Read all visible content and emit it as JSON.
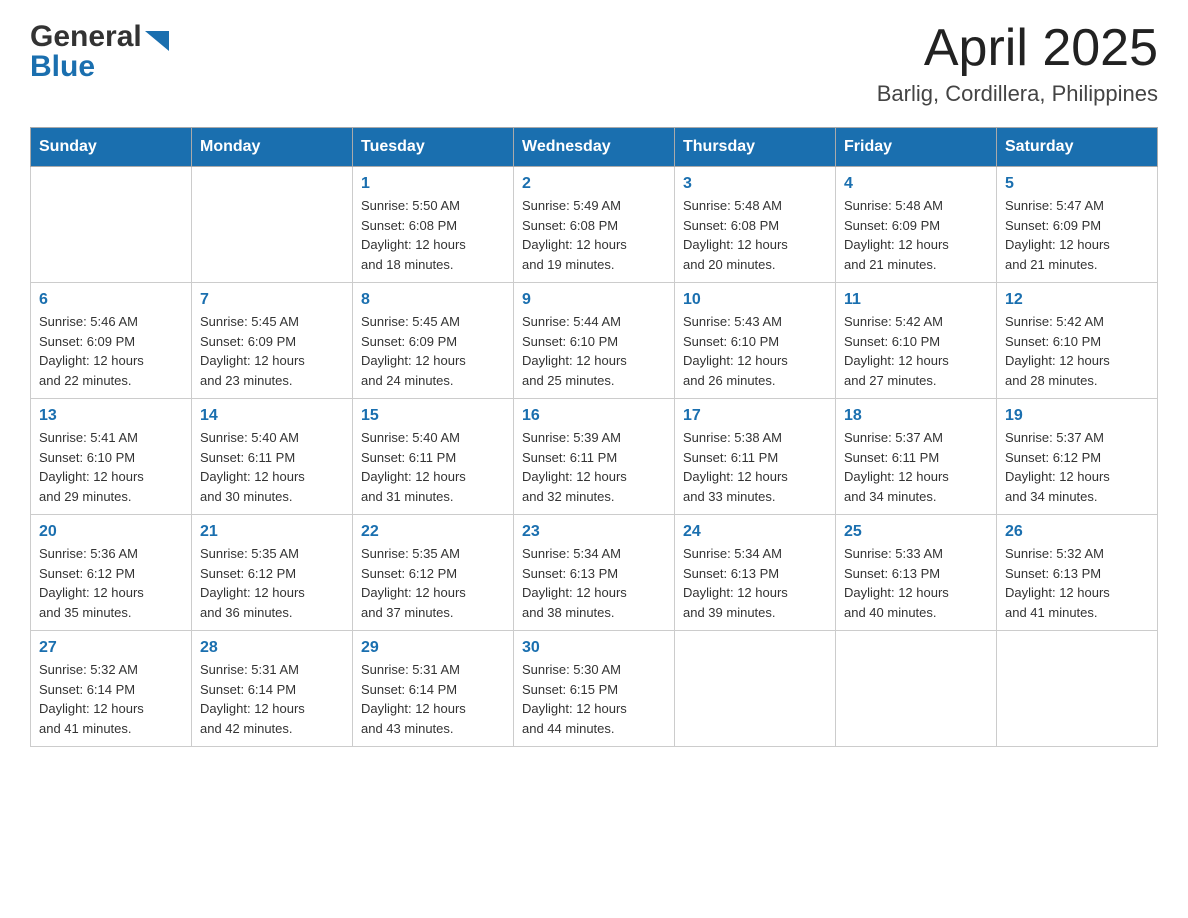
{
  "header": {
    "logo_general": "General",
    "logo_blue": "Blue",
    "month_title": "April 2025",
    "location": "Barlig, Cordillera, Philippines"
  },
  "days_of_week": [
    "Sunday",
    "Monday",
    "Tuesday",
    "Wednesday",
    "Thursday",
    "Friday",
    "Saturday"
  ],
  "weeks": [
    [
      {
        "day": "",
        "info": ""
      },
      {
        "day": "",
        "info": ""
      },
      {
        "day": "1",
        "info": "Sunrise: 5:50 AM\nSunset: 6:08 PM\nDaylight: 12 hours\nand 18 minutes."
      },
      {
        "day": "2",
        "info": "Sunrise: 5:49 AM\nSunset: 6:08 PM\nDaylight: 12 hours\nand 19 minutes."
      },
      {
        "day": "3",
        "info": "Sunrise: 5:48 AM\nSunset: 6:08 PM\nDaylight: 12 hours\nand 20 minutes."
      },
      {
        "day": "4",
        "info": "Sunrise: 5:48 AM\nSunset: 6:09 PM\nDaylight: 12 hours\nand 21 minutes."
      },
      {
        "day": "5",
        "info": "Sunrise: 5:47 AM\nSunset: 6:09 PM\nDaylight: 12 hours\nand 21 minutes."
      }
    ],
    [
      {
        "day": "6",
        "info": "Sunrise: 5:46 AM\nSunset: 6:09 PM\nDaylight: 12 hours\nand 22 minutes."
      },
      {
        "day": "7",
        "info": "Sunrise: 5:45 AM\nSunset: 6:09 PM\nDaylight: 12 hours\nand 23 minutes."
      },
      {
        "day": "8",
        "info": "Sunrise: 5:45 AM\nSunset: 6:09 PM\nDaylight: 12 hours\nand 24 minutes."
      },
      {
        "day": "9",
        "info": "Sunrise: 5:44 AM\nSunset: 6:10 PM\nDaylight: 12 hours\nand 25 minutes."
      },
      {
        "day": "10",
        "info": "Sunrise: 5:43 AM\nSunset: 6:10 PM\nDaylight: 12 hours\nand 26 minutes."
      },
      {
        "day": "11",
        "info": "Sunrise: 5:42 AM\nSunset: 6:10 PM\nDaylight: 12 hours\nand 27 minutes."
      },
      {
        "day": "12",
        "info": "Sunrise: 5:42 AM\nSunset: 6:10 PM\nDaylight: 12 hours\nand 28 minutes."
      }
    ],
    [
      {
        "day": "13",
        "info": "Sunrise: 5:41 AM\nSunset: 6:10 PM\nDaylight: 12 hours\nand 29 minutes."
      },
      {
        "day": "14",
        "info": "Sunrise: 5:40 AM\nSunset: 6:11 PM\nDaylight: 12 hours\nand 30 minutes."
      },
      {
        "day": "15",
        "info": "Sunrise: 5:40 AM\nSunset: 6:11 PM\nDaylight: 12 hours\nand 31 minutes."
      },
      {
        "day": "16",
        "info": "Sunrise: 5:39 AM\nSunset: 6:11 PM\nDaylight: 12 hours\nand 32 minutes."
      },
      {
        "day": "17",
        "info": "Sunrise: 5:38 AM\nSunset: 6:11 PM\nDaylight: 12 hours\nand 33 minutes."
      },
      {
        "day": "18",
        "info": "Sunrise: 5:37 AM\nSunset: 6:11 PM\nDaylight: 12 hours\nand 34 minutes."
      },
      {
        "day": "19",
        "info": "Sunrise: 5:37 AM\nSunset: 6:12 PM\nDaylight: 12 hours\nand 34 minutes."
      }
    ],
    [
      {
        "day": "20",
        "info": "Sunrise: 5:36 AM\nSunset: 6:12 PM\nDaylight: 12 hours\nand 35 minutes."
      },
      {
        "day": "21",
        "info": "Sunrise: 5:35 AM\nSunset: 6:12 PM\nDaylight: 12 hours\nand 36 minutes."
      },
      {
        "day": "22",
        "info": "Sunrise: 5:35 AM\nSunset: 6:12 PM\nDaylight: 12 hours\nand 37 minutes."
      },
      {
        "day": "23",
        "info": "Sunrise: 5:34 AM\nSunset: 6:13 PM\nDaylight: 12 hours\nand 38 minutes."
      },
      {
        "day": "24",
        "info": "Sunrise: 5:34 AM\nSunset: 6:13 PM\nDaylight: 12 hours\nand 39 minutes."
      },
      {
        "day": "25",
        "info": "Sunrise: 5:33 AM\nSunset: 6:13 PM\nDaylight: 12 hours\nand 40 minutes."
      },
      {
        "day": "26",
        "info": "Sunrise: 5:32 AM\nSunset: 6:13 PM\nDaylight: 12 hours\nand 41 minutes."
      }
    ],
    [
      {
        "day": "27",
        "info": "Sunrise: 5:32 AM\nSunset: 6:14 PM\nDaylight: 12 hours\nand 41 minutes."
      },
      {
        "day": "28",
        "info": "Sunrise: 5:31 AM\nSunset: 6:14 PM\nDaylight: 12 hours\nand 42 minutes."
      },
      {
        "day": "29",
        "info": "Sunrise: 5:31 AM\nSunset: 6:14 PM\nDaylight: 12 hours\nand 43 minutes."
      },
      {
        "day": "30",
        "info": "Sunrise: 5:30 AM\nSunset: 6:15 PM\nDaylight: 12 hours\nand 44 minutes."
      },
      {
        "day": "",
        "info": ""
      },
      {
        "day": "",
        "info": ""
      },
      {
        "day": "",
        "info": ""
      }
    ]
  ]
}
